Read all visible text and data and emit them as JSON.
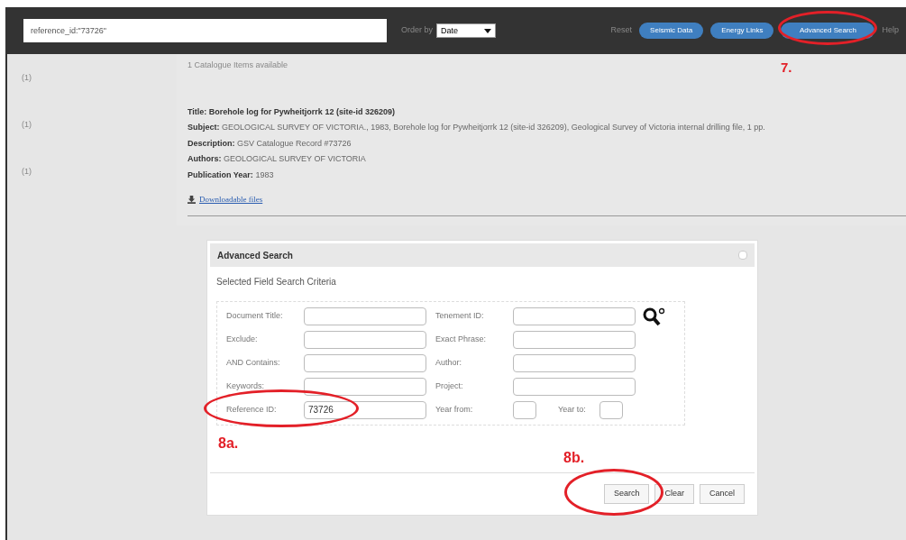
{
  "header": {
    "search_value": "reference_id:\"73726\"",
    "order_label": "Order by",
    "order_value": "Date",
    "reset": "Reset",
    "buttons": [
      "Seismic Data",
      "Energy Links",
      "Advanced Search"
    ],
    "help": "Help"
  },
  "sidebar": {
    "items": [
      "(1)",
      "(1)",
      "(1)"
    ]
  },
  "results": {
    "count": "1 Catalogue Items available",
    "record": [
      {
        "label": "Title:",
        "value": "Borehole log for Pywheitjorrk 12 (site-id 326209)",
        "kind": "title"
      },
      {
        "label": "Subject:",
        "value": "GEOLOGICAL SURVEY OF VICTORIA., 1983, Borehole log for Pywheitjorrk 12 (site-id 326209), Geological Survey of Victoria internal drilling file, 1 pp.",
        "kind": "field"
      },
      {
        "label": "Description:",
        "value": "GSV Catalogue Record #73726",
        "kind": "field"
      },
      {
        "label": "Authors:",
        "value": "GEOLOGICAL SURVEY OF VICTORIA",
        "kind": "field"
      },
      {
        "label": "Publication Year:",
        "value": "1983",
        "kind": "field"
      }
    ],
    "download_link": "Downloadable files"
  },
  "dialog": {
    "title": "Advanced Search",
    "subtitle": "Selected Field Search Criteria",
    "rows": [
      [
        {
          "label": "Document Title:"
        },
        {
          "label": "Tenement ID:"
        }
      ],
      [
        {
          "label": "Exclude:"
        },
        {
          "label": "Exact Phrase:"
        }
      ],
      [
        {
          "label": "AND Contains:"
        },
        {
          "label": "Author:"
        }
      ],
      [
        {
          "label": "Keywords:"
        },
        {
          "label": "Project:"
        }
      ],
      [
        {
          "label": "Reference ID:",
          "value": "73726"
        },
        {
          "label": "Year from:",
          "kind": "small"
        },
        {
          "label": "Year to:",
          "kind": "small"
        }
      ]
    ],
    "buttons": [
      "Search",
      "Clear",
      "Cancel"
    ]
  },
  "annotations": [
    {
      "label": "7."
    },
    {
      "label": "8a."
    },
    {
      "label": "8b."
    }
  ]
}
